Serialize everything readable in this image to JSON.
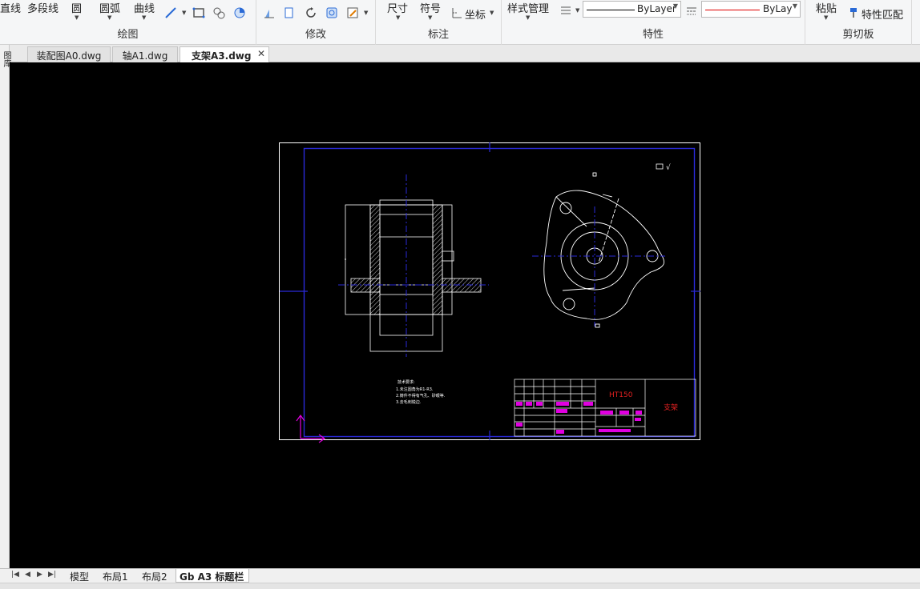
{
  "ribbon": {
    "draw": {
      "label": "绘图",
      "line": "直线",
      "polyline": "多段线",
      "circle": "圆",
      "arc": "圆弧",
      "curve": "曲线"
    },
    "modify": {
      "label": "修改"
    },
    "annotate": {
      "label": "标注",
      "dimension": "尺寸",
      "symbol": "符号",
      "coordinate": "坐标"
    },
    "properties": {
      "label": "特性",
      "style_manager": "样式管理",
      "linetype": "ByLayer",
      "color": "ByLay"
    },
    "clipboard": {
      "label": "剪切板",
      "paste": "粘贴",
      "match_props": "特性匹配"
    },
    "colors": {
      "linetype_line": "#000000",
      "color_line": "#e00000"
    }
  },
  "file_tabs": [
    {
      "label": "装配图A0.dwg"
    },
    {
      "label": "轴A1.dwg"
    },
    {
      "label": "支架A3.dwg",
      "active": true
    }
  ],
  "left_strip": {
    "label": "图库"
  },
  "drawing": {
    "material": "HT150",
    "part_name": "支架",
    "notes": [
      "技术要求:",
      "1.未注圆角为R1-R3.",
      "2.铸件不得有气孔、砂眼等.",
      "3.去毛刺锐边."
    ],
    "roughness": "√"
  },
  "layout_tabs": [
    {
      "label": "模型"
    },
    {
      "label": "布局1"
    },
    {
      "label": "布局2"
    },
    {
      "label": "Gb A3 标题栏",
      "active": true
    }
  ]
}
